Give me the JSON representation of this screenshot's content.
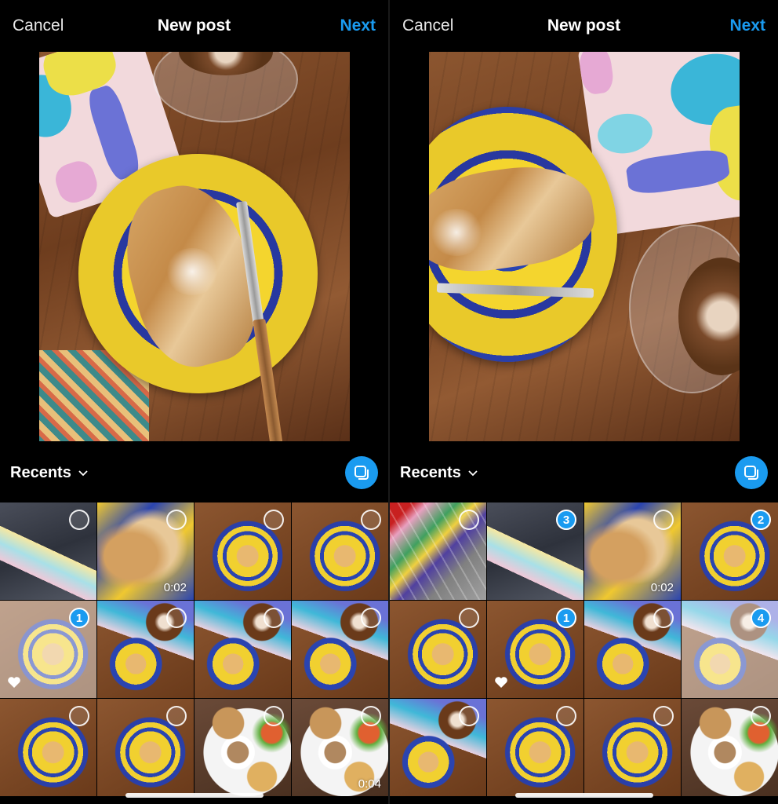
{
  "screens": [
    {
      "header": {
        "cancel": "Cancel",
        "title": "New post",
        "next": "Next"
      },
      "preview": {
        "description": "Almond croissant on blue-and-yellow patterned plate with fork, latte and notebook"
      },
      "toolbar": {
        "album": "Recents",
        "album_icon": "chevron-down-icon",
        "multi_select_icon": "multi-select-icon"
      },
      "grid": [
        {
          "scene": "blanket",
          "selected": false
        },
        {
          "scene": "close",
          "selected": false,
          "duration": "0:02"
        },
        {
          "scene": "plate",
          "selected": false
        },
        {
          "scene": "plate",
          "selected": false
        },
        {
          "scene": "plate",
          "selected": true,
          "order": "1",
          "dimmed": true,
          "favorite": true
        },
        {
          "scene": "coffee",
          "selected": false
        },
        {
          "scene": "coffee",
          "selected": false
        },
        {
          "scene": "coffee",
          "selected": false
        },
        {
          "scene": "plate",
          "selected": false
        },
        {
          "scene": "plate",
          "selected": false
        },
        {
          "scene": "gravy",
          "selected": false
        },
        {
          "scene": "gravy",
          "selected": false,
          "duration": "0:04"
        }
      ]
    },
    {
      "header": {
        "cancel": "Cancel",
        "title": "New post",
        "next": "Next"
      },
      "preview": {
        "description": "Almond croissant on patterned plate with fork, notebook and latte art"
      },
      "toolbar": {
        "album": "Recents",
        "album_icon": "chevron-down-icon",
        "multi_select_icon": "multi-select-icon"
      },
      "grid": [
        {
          "scene": "cart",
          "selected": false
        },
        {
          "scene": "blanket",
          "selected": true,
          "order": "3"
        },
        {
          "scene": "close",
          "selected": false,
          "duration": "0:02"
        },
        {
          "scene": "plate",
          "selected": true,
          "order": "2"
        },
        {
          "scene": "plate",
          "selected": false
        },
        {
          "scene": "plate",
          "selected": true,
          "order": "1",
          "favorite": true
        },
        {
          "scene": "coffee",
          "selected": false
        },
        {
          "scene": "coffee",
          "selected": true,
          "order": "4",
          "dimmed": true
        },
        {
          "scene": "coffee",
          "selected": false
        },
        {
          "scene": "plate",
          "selected": false
        },
        {
          "scene": "plate",
          "selected": false
        },
        {
          "scene": "gravy",
          "selected": false
        }
      ]
    }
  ],
  "colors": {
    "accent": "#1a9bf0",
    "background": "#000000",
    "text": "#ffffff"
  }
}
